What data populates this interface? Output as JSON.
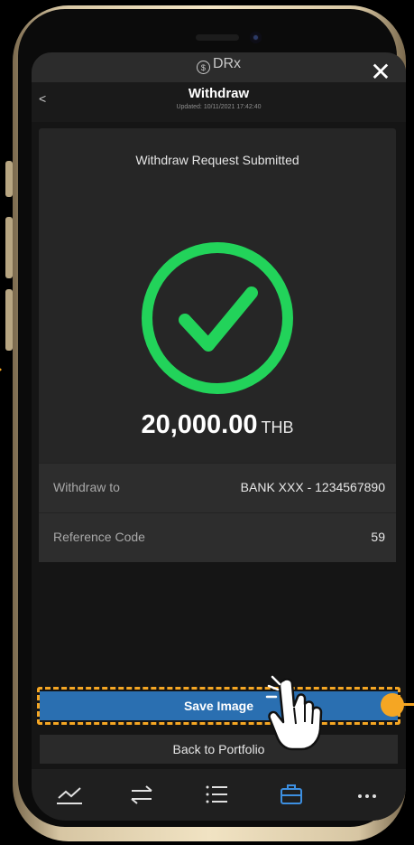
{
  "browser": {
    "brand": "DRx",
    "close_icon": "close-icon"
  },
  "header": {
    "title": "Withdraw",
    "updated": "Updated: 10/11/2021 17:42:40",
    "back_label": "<"
  },
  "result": {
    "title": "Withdraw Request Submitted",
    "amount": "20,000.00",
    "currency": "THB",
    "success_color": "#22d35a"
  },
  "details": [
    {
      "label": "Withdraw to",
      "value": "BANK XXX - 1234567890"
    },
    {
      "label": "Reference Code",
      "value": "59"
    }
  ],
  "actions": {
    "save_label": "Save Image",
    "back_label": "Back to Portfolio"
  },
  "nav": {
    "items": [
      {
        "name": "chart-icon",
        "active": false
      },
      {
        "name": "transfer-icon",
        "active": false
      },
      {
        "name": "list-icon",
        "active": false
      },
      {
        "name": "briefcase-icon",
        "active": true
      },
      {
        "name": "more-icon",
        "active": false
      }
    ],
    "active_color": "#3d8fe0"
  },
  "annotation": {
    "highlight_color": "#f5a623"
  }
}
